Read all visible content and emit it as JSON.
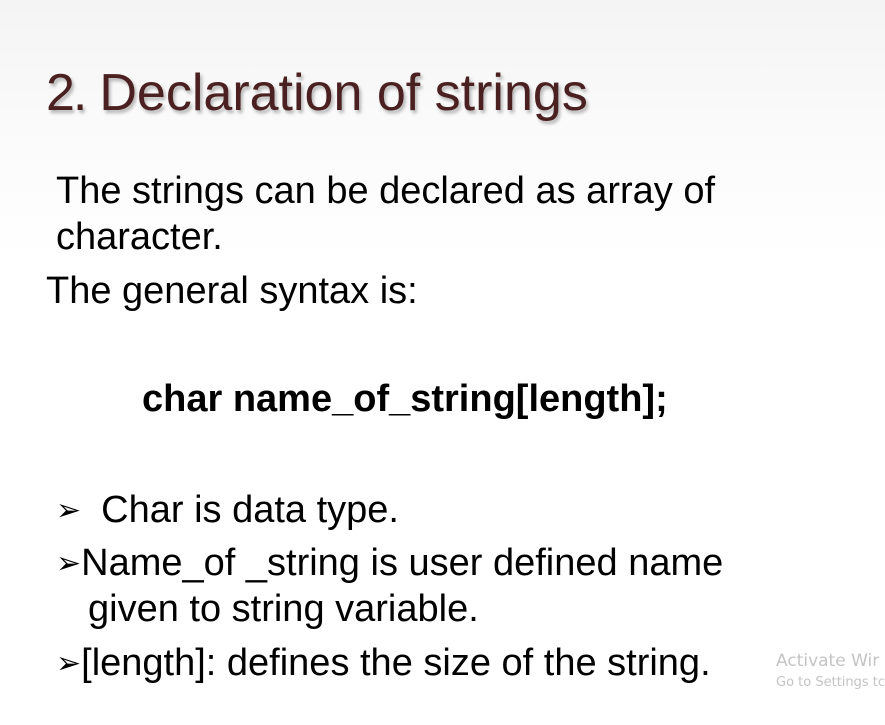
{
  "slide": {
    "title_number": "2.",
    "title_text": "Declaration of strings",
    "intro_line1": "The strings can be declared as array of",
    "intro_line2": "character.",
    "syntax_label": "The general syntax is:",
    "syntax_code": "char name_of_string[length];",
    "bullet_marker": "➢",
    "bullets": [
      {
        "lines": [
          "Char is data type."
        ]
      },
      {
        "lines": [
          "Name_of _string is user defined name",
          "given to string variable."
        ]
      },
      {
        "lines": [
          "[length]: defines the size of the string."
        ]
      }
    ]
  },
  "watermark": {
    "line1": "Activate Wir",
    "line2": "Go to Settings tc"
  },
  "colors": {
    "title": "#4a2020",
    "body_text": "#000000",
    "watermark": "#c4c4c4"
  }
}
